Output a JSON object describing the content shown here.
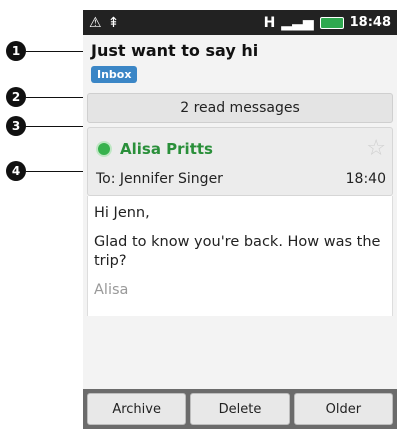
{
  "status": {
    "time": "18:48"
  },
  "email": {
    "subject": "Just want to say hi",
    "label": "Inbox",
    "read_messages": "2 read messages",
    "sender": "Alisa Pritts",
    "to": "To: Jennifer Singer",
    "time": "18:40",
    "body_greeting": "Hi Jenn,",
    "body_line": "Glad to know you're back. How was the trip?",
    "signature": "Alisa"
  },
  "buttons": {
    "archive": "Archive",
    "delete": "Delete",
    "older": "Older"
  },
  "callouts": [
    "1",
    "2",
    "3",
    "4"
  ]
}
